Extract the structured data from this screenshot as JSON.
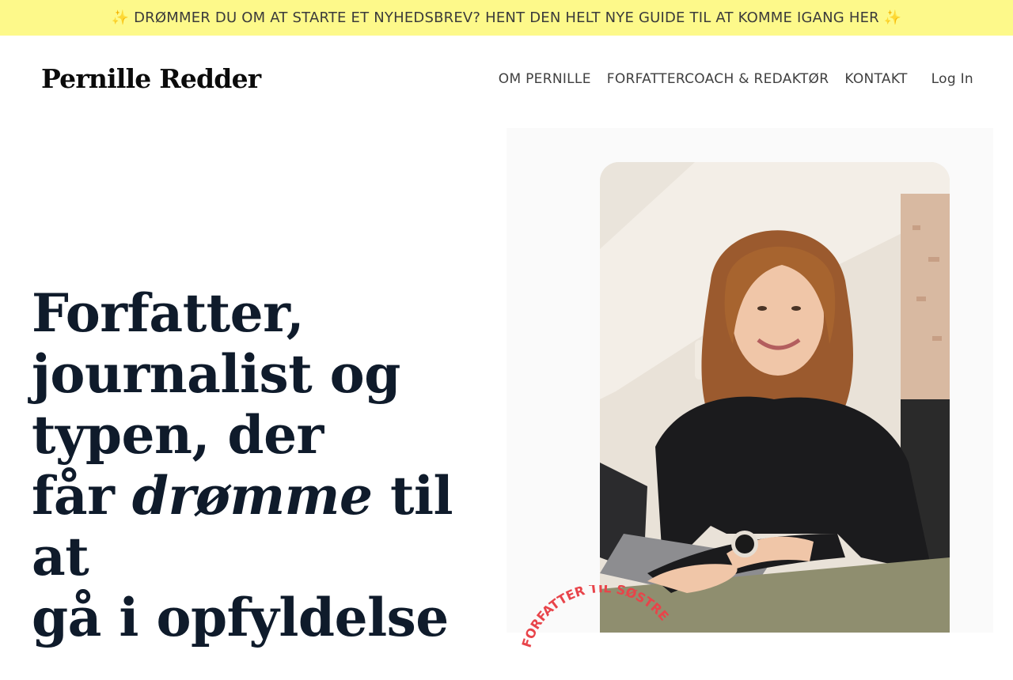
{
  "announcement": {
    "text": "✨ DRØMMER DU OM AT STARTE ET NYHEDSBREV? HENT DEN HELT NYE GUIDE TIL AT KOMME IGANG HER ✨",
    "background": "#fdf98a"
  },
  "header": {
    "logo": "Pernille Redder",
    "nav": [
      {
        "label": "OM PERNILLE"
      },
      {
        "label": "FORFATTERCOACH & REDAKTØR"
      },
      {
        "label": "KONTAKT"
      }
    ],
    "login": "Log In"
  },
  "hero": {
    "headline": {
      "line1": "Forfatter,",
      "line2": "journalist og",
      "line3": "typen, der",
      "line4_pre": "får ",
      "line4_em": "drømme",
      "line4_post": " til at",
      "line5": "gå i opfyldelse"
    },
    "badge_text": "FORFATTER TIL SØSTRENE",
    "badge_color": "#e8444a",
    "text_color": "#0f1b2b"
  }
}
